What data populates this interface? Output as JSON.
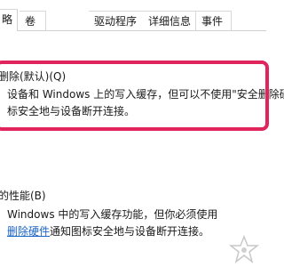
{
  "tabs": [
    {
      "label": "略",
      "active": true
    },
    {
      "label": "卷",
      "active": false
    },
    {
      "label": "驱动程序",
      "active": false
    },
    {
      "label": "详细信息",
      "active": false
    },
    {
      "label": "事件",
      "active": false
    }
  ],
  "option_quick_removal": {
    "title": "删除(默认)(Q)",
    "desc_line1": "设备和 Windows 上的写入缓存，但可以不使用\"安全删除硬",
    "desc_line2": "标安全地与设备断开连接。",
    "selected": true
  },
  "option_better_performance": {
    "title": "的性能(B)",
    "desc_line1": "Windows 中的写入缓存功能，但你必须使用",
    "desc_link": "删除硬件",
    "desc_line2_rest": "通知图标安全地与设备断开连接。"
  },
  "colors": {
    "highlight": "#e0245c",
    "link": "#1a64c8"
  },
  "watermark": {
    "icon": "star-logo-icon"
  }
}
